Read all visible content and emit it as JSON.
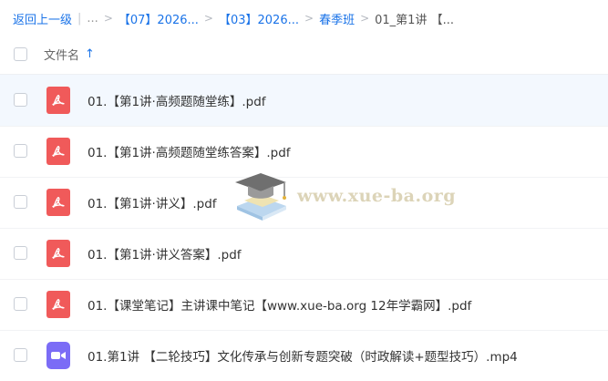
{
  "breadcrumb": {
    "back": "返回上一级",
    "ellipsis": "...",
    "sep": ">",
    "items": [
      "【07】2026...",
      "【03】2026...",
      "春季班"
    ],
    "current": "01_第1讲 【..."
  },
  "header": {
    "column_title": "文件名",
    "sort_arrow": "↑"
  },
  "files": [
    {
      "name": "01.【第1讲·高频题随堂练】.pdf",
      "type": "pdf"
    },
    {
      "name": "01.【第1讲·高频题随堂练答案】.pdf",
      "type": "pdf"
    },
    {
      "name": "01.【第1讲·讲义】.pdf",
      "type": "pdf"
    },
    {
      "name": "01.【第1讲·讲义答案】.pdf",
      "type": "pdf"
    },
    {
      "name": "01.【课堂笔记】主讲课中笔记【www.xue-ba.org 12年学霸网】.pdf",
      "type": "pdf"
    },
    {
      "name": "01.第1讲 【二轮技巧】文化传承与创新专题突破（时政解读+题型技巧）.mp4",
      "type": "video"
    }
  ],
  "watermark": {
    "text": "www.xue-ba.org"
  },
  "colors": {
    "accent": "#1a73e8",
    "pdf": "#f05a5a",
    "video": "#7b6cf6",
    "selected_row": "#f3f8fe"
  },
  "icons": {
    "pdf": "pdf-file-icon",
    "video": "video-file-icon",
    "watermark": "graduation-cap-icon"
  }
}
